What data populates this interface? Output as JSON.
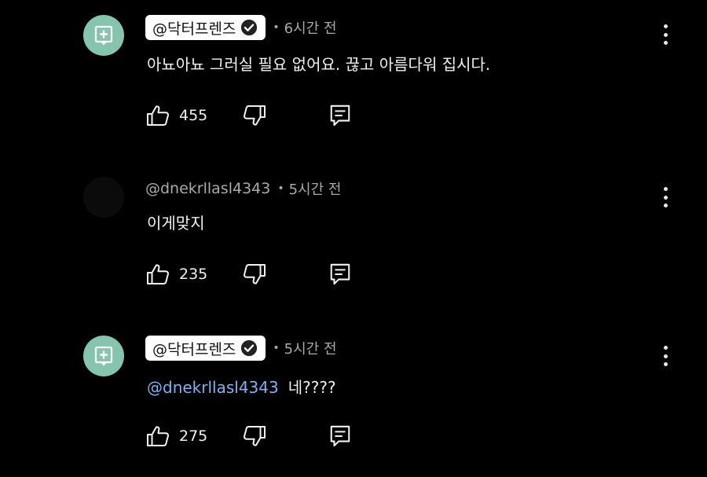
{
  "comments": [
    {
      "author": "@닥터프렌즈",
      "verified": true,
      "avatar": "channel-logo",
      "time": "6시간 전",
      "text": "아뇨아뇨 그러실 필요 없어요. 끊고 아름다워 집시다.",
      "mention": "",
      "likes": "455"
    },
    {
      "author": "@dnekrllasl4343",
      "verified": false,
      "avatar": "user-photo",
      "time": "5시간 전",
      "text": "이게맞지",
      "mention": "",
      "likes": "235"
    },
    {
      "author": "@닥터프렌즈",
      "verified": true,
      "avatar": "channel-logo",
      "time": "5시간 전",
      "text": "네????",
      "mention": "@dnekrllasl4343",
      "likes": "275"
    }
  ],
  "icons": {
    "like": "thumbs-up-icon",
    "dislike": "thumbs-down-icon",
    "reply": "reply-comment-icon",
    "more": "more-vertical-icon",
    "verified": "verified-check-icon"
  },
  "colors": {
    "background": "#000000",
    "avatar_channel": "#86c5ad",
    "mention": "#7fb1f5",
    "secondary_text": "#aaaaaa"
  }
}
